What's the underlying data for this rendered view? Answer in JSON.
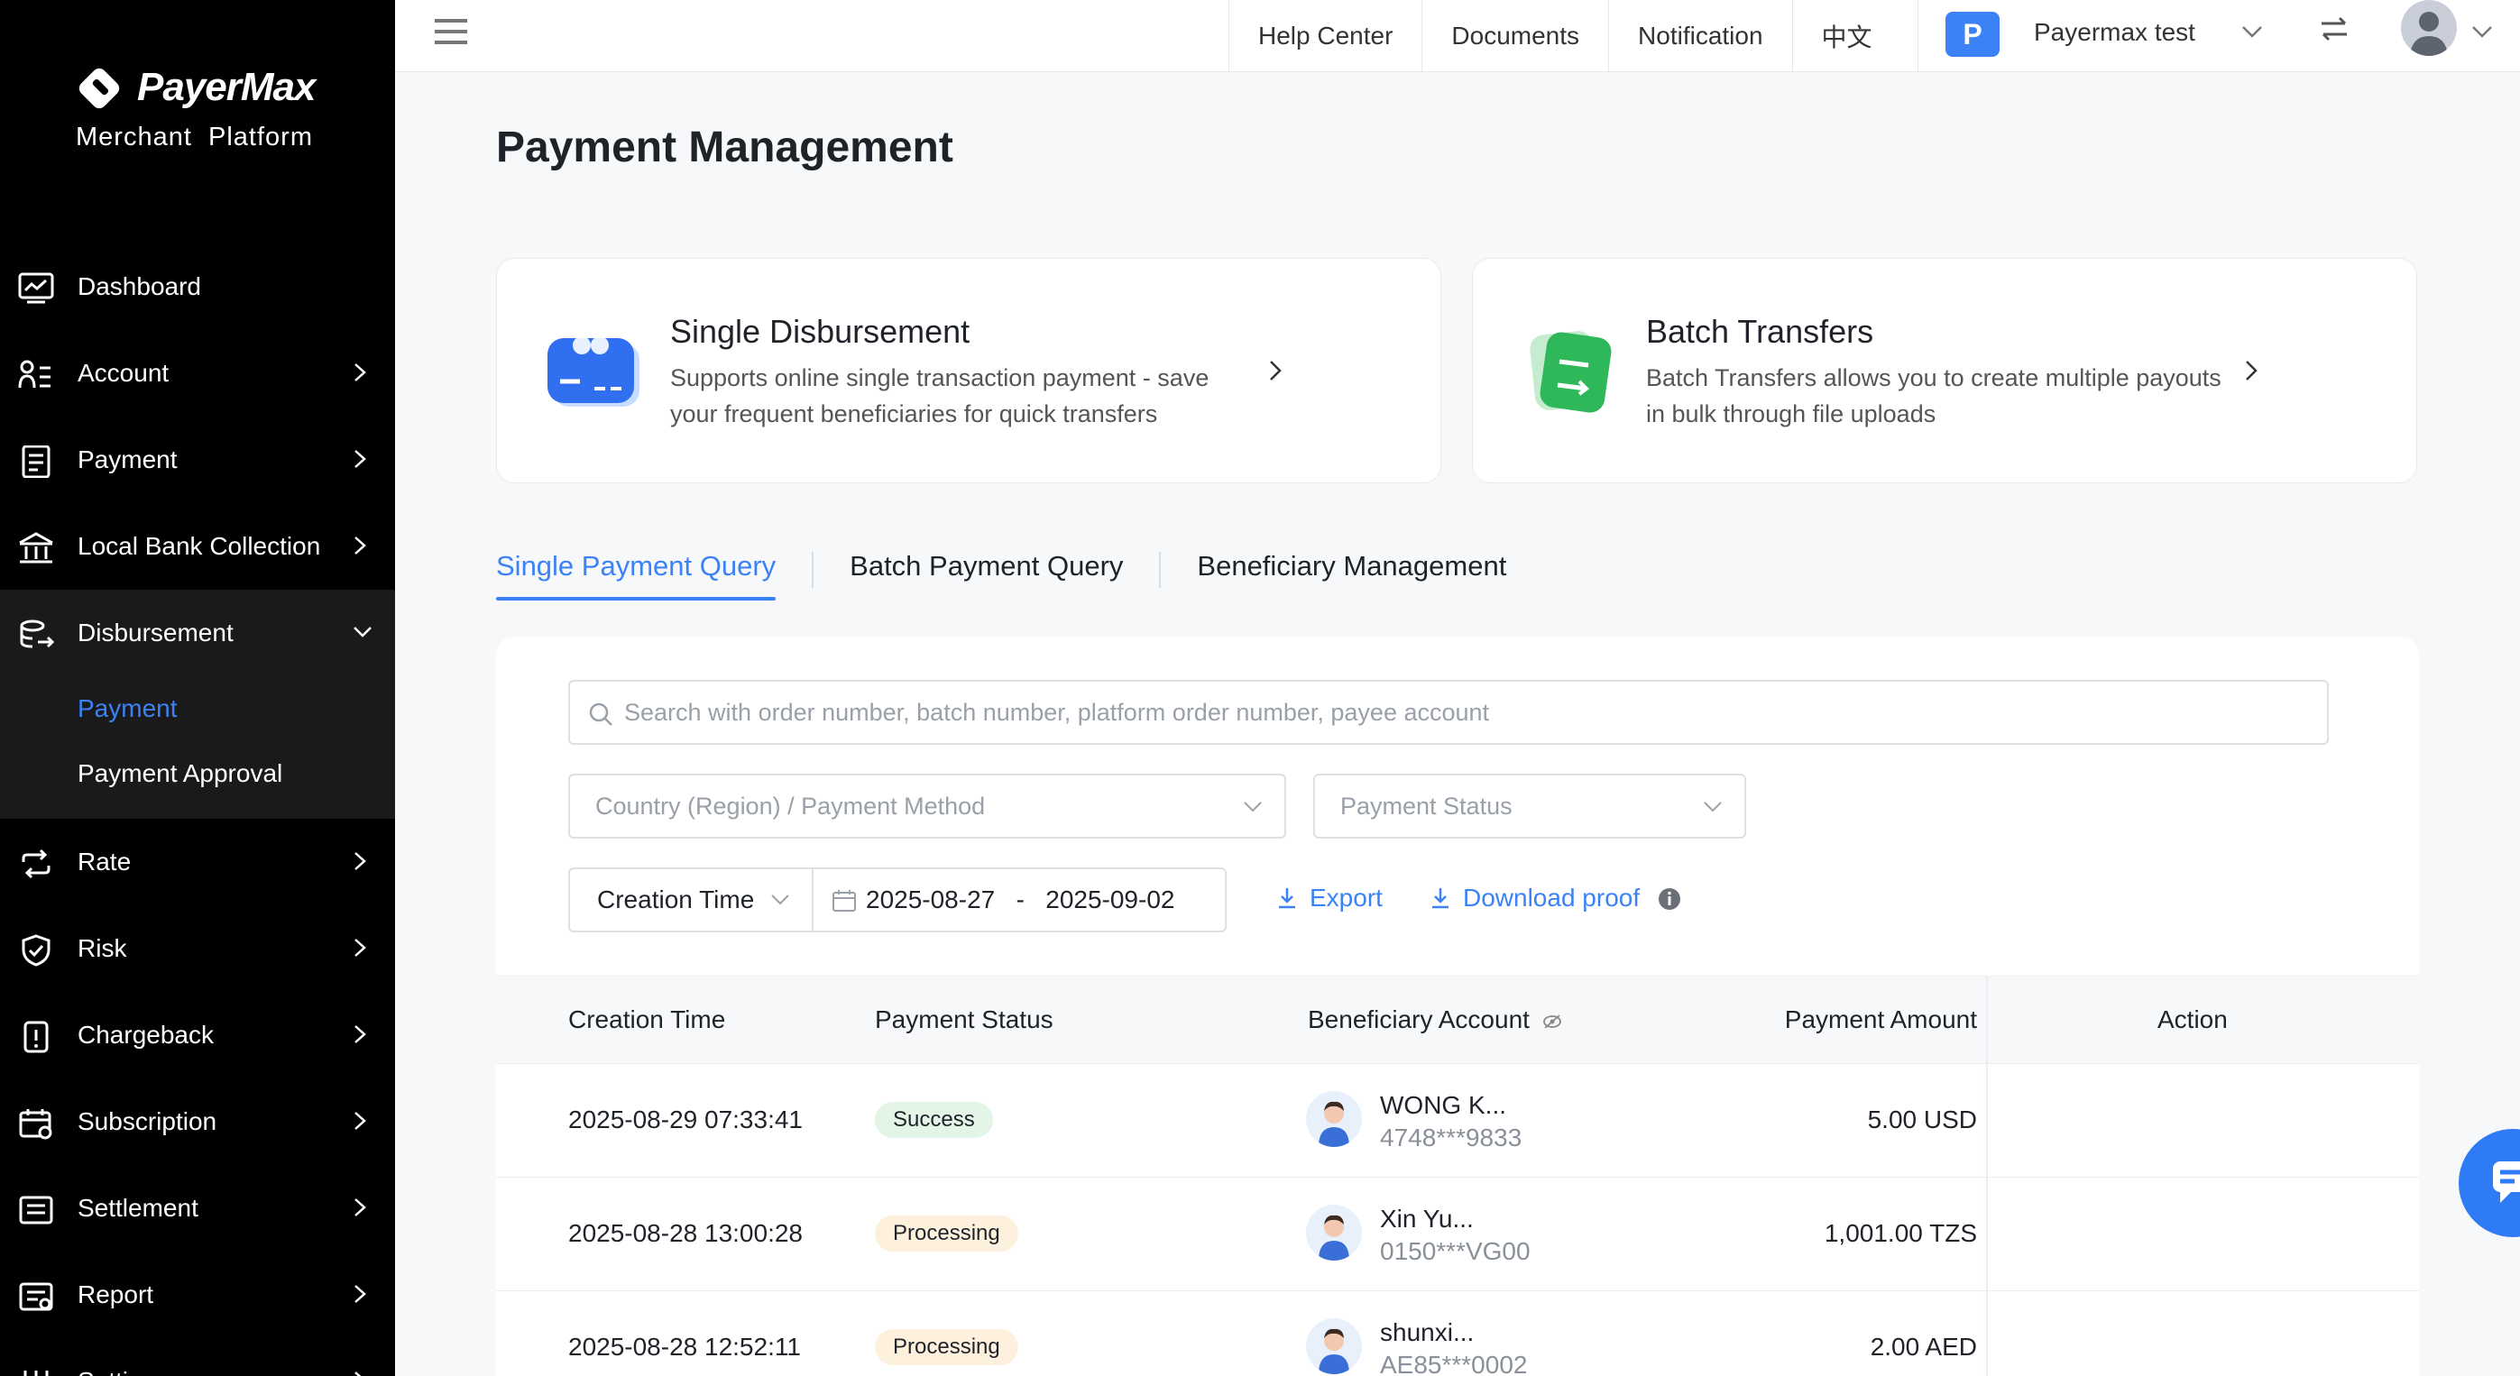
{
  "brand": {
    "name": "PayerMax",
    "subtitle": "Merchant  Platform"
  },
  "sidebar": {
    "items": [
      {
        "label": "Dashboard",
        "icon": "dashboard-icon",
        "has_chevron": false
      },
      {
        "label": "Account",
        "icon": "account-icon",
        "has_chevron": true
      },
      {
        "label": "Payment",
        "icon": "payment-doc-icon",
        "has_chevron": true
      },
      {
        "label": "Local Bank Collection",
        "icon": "bank-icon",
        "has_chevron": true
      },
      {
        "label": "Disbursement",
        "icon": "disbursement-icon",
        "expanded": true,
        "children": [
          {
            "label": "Payment",
            "active": true
          },
          {
            "label": "Payment Approval",
            "active": false
          }
        ]
      },
      {
        "label": "Rate",
        "icon": "rate-icon",
        "has_chevron": true
      },
      {
        "label": "Risk",
        "icon": "shield-icon",
        "has_chevron": true
      },
      {
        "label": "Chargeback",
        "icon": "chargeback-icon",
        "has_chevron": true
      },
      {
        "label": "Subscription",
        "icon": "subscription-icon",
        "has_chevron": true
      },
      {
        "label": "Settlement",
        "icon": "settlement-icon",
        "has_chevron": true
      },
      {
        "label": "Report",
        "icon": "report-icon",
        "has_chevron": true
      },
      {
        "label": "Settings",
        "icon": "settings-icon",
        "has_chevron": true
      }
    ]
  },
  "topbar": {
    "links": [
      "Help Center",
      "Documents",
      "Notification",
      "中文"
    ],
    "org_badge": "P",
    "org_name": "Payermax test"
  },
  "page": {
    "title": "Payment Management"
  },
  "cards": [
    {
      "title": "Single Disbursement",
      "description": "Supports online single transaction payment - save your frequent beneficiaries for quick transfers"
    },
    {
      "title": "Batch Transfers",
      "description": "Batch Transfers allows you to create multiple payouts in bulk through file uploads"
    }
  ],
  "tabs": [
    {
      "label": "Single Payment Query",
      "active": true
    },
    {
      "label": "Batch Payment Query",
      "active": false
    },
    {
      "label": "Beneficiary Management",
      "active": false
    }
  ],
  "filters": {
    "search_placeholder": "Search with order number, batch number, platform order number, payee account",
    "country_placeholder": "Country (Region) / Payment Method",
    "status_placeholder": "Payment Status",
    "date_type": "Creation Time",
    "date_from": "2025-08-27",
    "date_to": "2025-09-02",
    "date_separator": "-",
    "export_label": "Export",
    "download_label": "Download proof"
  },
  "table": {
    "headers": {
      "creation_time": "Creation Time",
      "status": "Payment Status",
      "beneficiary": "Beneficiary Account",
      "amount": "Payment Amount",
      "action": "Action"
    },
    "rows": [
      {
        "time": "2025-08-29 07:33:41",
        "status": "Success",
        "status_type": "success",
        "name": "WONG K...",
        "account": "4748***9833",
        "amount": "5.00 USD"
      },
      {
        "time": "2025-08-28 13:00:28",
        "status": "Processing",
        "status_type": "processing",
        "name": "Xin Yu...",
        "account": "0150***VG00",
        "amount": "1,001.00 TZS"
      },
      {
        "time": "2025-08-28 12:52:11",
        "status": "Processing",
        "status_type": "processing",
        "name": "shunxi...",
        "account": "AE85***0002",
        "amount": "2.00 AED"
      }
    ]
  },
  "colors": {
    "accent": "#3b82f6",
    "sidebar_bg": "#000000",
    "success_bg": "#e3f5e6",
    "processing_bg": "#fdf1dd"
  }
}
